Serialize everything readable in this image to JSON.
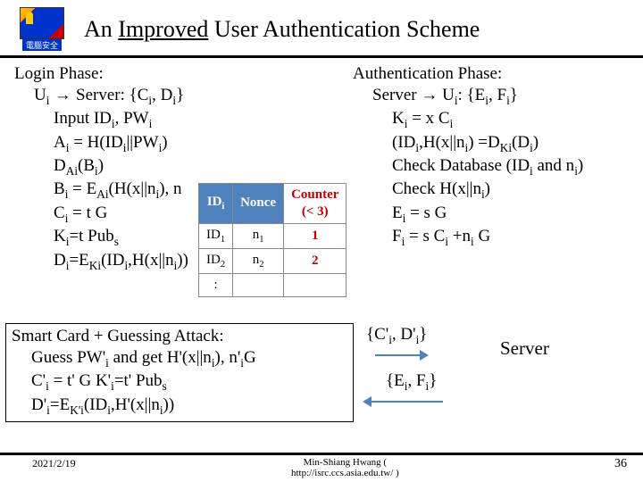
{
  "logo_label": "電腦安全",
  "title_prefix": "An ",
  "title_underlined": "Improved",
  "title_suffix": " User Authentication Scheme",
  "login": {
    "heading": "Login Phase:",
    "line1_pre": "U",
    "line1_sub": "i",
    "arrow": " → ",
    "line1_post": "Server: {C",
    "line1_sub2": "i",
    "line1_post2": ", D",
    "line1_sub3": "i",
    "line1_post3": "}",
    "l2": "Input ID",
    "l2_sub": "i",
    "l2_b": ", PW",
    "l2_sub2": "i",
    "l3": "A",
    "l3_s": "i",
    "l3_b": " = H(ID",
    "l3_s2": "i",
    "l3_c": "||PW",
    "l3_s3": "i",
    "l3_d": ")",
    "l4": "D",
    "l4_s": "Ai",
    "l4_b": "(B",
    "l4_s2": "i",
    "l4_c": ")",
    "l5": "B",
    "l5_s": "i",
    "l5_b": " = E",
    "l5_s2": "Ai",
    "l5_c": "(H(x||n",
    "l5_s3": "i",
    "l5_d": "), n",
    "l6": "C",
    "l6_s": "i",
    "l6_b": " = t G",
    "l7": "K",
    "l7_s": "i",
    "l7_b": "=t Pub",
    "l7_s2": "s",
    "l8": "D",
    "l8_s": "i",
    "l8_b": "=E",
    "l8_s2": "Ki",
    "l8_c": "(ID",
    "l8_s3": "i",
    "l8_d": ",H(x||n",
    "l8_s4": "i",
    "l8_e": "))"
  },
  "auth": {
    "heading": "Authentication Phase:",
    "l1_a": "Server ",
    "arrow": "→",
    "l1_b": " U",
    "l1_s": "i",
    "l1_c": ": {E",
    "l1_s2": "i",
    "l1_d": ", F",
    "l1_s3": "i",
    "l1_e": "}",
    "l2": "K",
    "l2_s": "i",
    "l2_b": " = x C",
    "l2_s2": "i",
    "l3": "(ID",
    "l3_s": "i",
    "l3_b": ",H(x||n",
    "l3_s2": "i",
    "l3_c": ") =D",
    "l3_s3": "Ki",
    "l3_d": "(D",
    "l3_s4": "i",
    "l3_e": ")",
    "l4": "Check Database (ID",
    "l4_s": "i",
    "l4_b": " and n",
    "l4_s2": "i",
    "l4_c": ")",
    "l5": "Check H(x||n",
    "l5_s": "i",
    "l5_b": ")",
    "l6": "E",
    "l6_s": "i",
    "l6_b": " = s G",
    "l7": "F",
    "l7_s": "i",
    "l7_b": " = s C",
    "l7_s2": "i",
    "l7_c": " +n",
    "l7_s3": "i",
    "l7_d": " G"
  },
  "table": {
    "h1": "ID",
    "h1s": "i",
    "h2": "Nonce",
    "h3": "Counter",
    "h3b": "(< 3)",
    "r1c1": "ID",
    "r1c1s": "1",
    "r1c2": "n",
    "r1c2s": "1",
    "r1c3": "1",
    "r2c1": "ID",
    "r2c1s": "2",
    "r2c2": "n",
    "r2c2s": "2",
    "r2c3": "2",
    "r3c1": ":"
  },
  "attack": {
    "l1": "Smart Card + Guessing Attack:",
    "l2a": "Guess  PW'",
    "l2s": "i",
    "l2b": "  and get H'(x||n",
    "l2s2": "i",
    "l2c": "), n'",
    "l2s3": "i",
    "l2d": "G",
    "l3a": "C'",
    "l3s": "i",
    "l3b": " = t' G        K'",
    "l3s2": "i",
    "l3c": "=t' Pub",
    "l3s3": "s",
    "l4a": "D'",
    "l4s": "i",
    "l4b": "=E",
    "l4s2": "K'i",
    "l4c": "(ID",
    "l4s3": "i",
    "l4d": ",H'(x||n",
    "l4s4": "i",
    "l4e": "))"
  },
  "msg1_a": "{C'",
  "msg1_s": "i",
  "msg1_b": ", D'",
  "msg1_s2": "i",
  "msg1_c": "}",
  "msg2_a": "{E",
  "msg2_s": "i",
  "msg2_b": ", F",
  "msg2_s2": "i",
  "msg2_c": "}",
  "server_label": "Server",
  "footer": {
    "date": "2021/2/19",
    "center1": "Min-Shiang Hwang (",
    "center2": "http://isrc.ccs.asia.edu.tw/ )",
    "page": "36"
  }
}
